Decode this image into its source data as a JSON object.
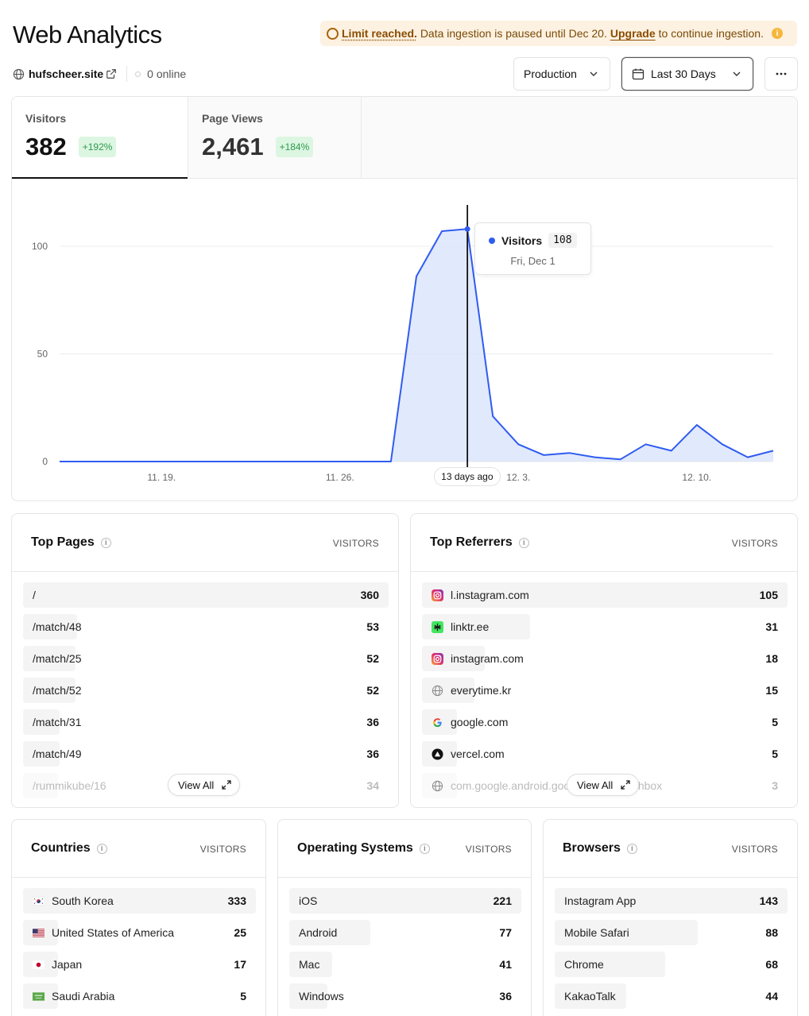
{
  "header": {
    "title": "Web Analytics",
    "banner": {
      "strong": "Limit reached.",
      "text": "Data ingestion is paused until Dec 20.",
      "link": "Upgrade",
      "tail": "to continue ingestion."
    },
    "site": "hufscheer.site",
    "online": "0 online",
    "environment": "Production",
    "range": "Last 30 Days"
  },
  "stats": {
    "visitors": {
      "label": "Visitors",
      "value": "382",
      "change": "+192%"
    },
    "page_views": {
      "label": "Page Views",
      "value": "2,461",
      "change": "+184%"
    }
  },
  "tooltip": {
    "series": "Visitors",
    "value": "108",
    "date": "Fri, Dec 1"
  },
  "chart_data": {
    "type": "area",
    "series": [
      {
        "name": "Visitors",
        "values": [
          0,
          0,
          0,
          0,
          0,
          0,
          0,
          0,
          0,
          0,
          0,
          0,
          0,
          0,
          86,
          107,
          108,
          21,
          8,
          3,
          4,
          2,
          1,
          8,
          5,
          17,
          8,
          2,
          5
        ]
      }
    ],
    "x_ticks": [
      "11. 19.",
      "11. 26.",
      "12. 3.",
      "12. 10."
    ],
    "highlight_label": "13 days ago",
    "y_ticks": [
      "0",
      "50",
      "100"
    ],
    "ylim": [
      0,
      115
    ],
    "color": "#2f5cf0"
  },
  "top_pages": {
    "title": "Top Pages",
    "column": "VISITORS",
    "view_all": "View All",
    "rows": [
      {
        "label": "/",
        "value": 360
      },
      {
        "label": "/match/48",
        "value": 53
      },
      {
        "label": "/match/25",
        "value": 52
      },
      {
        "label": "/match/52",
        "value": 52
      },
      {
        "label": "/match/31",
        "value": 36
      },
      {
        "label": "/match/49",
        "value": 36
      },
      {
        "label": "/rummikube/16",
        "value": 34
      }
    ]
  },
  "top_referrers": {
    "title": "Top Referrers",
    "column": "VISITORS",
    "view_all": "View All",
    "rows": [
      {
        "label": "l.instagram.com",
        "value": 105,
        "icon": "instagram-icon"
      },
      {
        "label": "linktr.ee",
        "value": 31,
        "icon": "linktree-icon"
      },
      {
        "label": "instagram.com",
        "value": 18,
        "icon": "instagram-icon"
      },
      {
        "label": "everytime.kr",
        "value": 15,
        "icon": "globe-icon"
      },
      {
        "label": "google.com",
        "value": 5,
        "icon": "google-icon"
      },
      {
        "label": "vercel.com",
        "value": 5,
        "icon": "vercel-icon"
      },
      {
        "label": "com.google.android.googlequicksearchbox",
        "value": 3,
        "icon": "globe-icon"
      }
    ]
  },
  "countries": {
    "title": "Countries",
    "column": "VISITORS",
    "rows": [
      {
        "label": "South Korea",
        "value": 333,
        "icon": "flag-kr-icon"
      },
      {
        "label": "United States of America",
        "value": 25,
        "icon": "flag-us-icon"
      },
      {
        "label": "Japan",
        "value": 17,
        "icon": "flag-jp-icon"
      },
      {
        "label": "Saudi Arabia",
        "value": 5,
        "icon": "flag-sa-icon"
      }
    ]
  },
  "operating_systems": {
    "title": "Operating Systems",
    "column": "VISITORS",
    "rows": [
      {
        "label": "iOS",
        "value": 221
      },
      {
        "label": "Android",
        "value": 77
      },
      {
        "label": "Mac",
        "value": 41
      },
      {
        "label": "Windows",
        "value": 36
      }
    ]
  },
  "browsers": {
    "title": "Browsers",
    "column": "VISITORS",
    "rows": [
      {
        "label": "Instagram App",
        "value": 143
      },
      {
        "label": "Mobile Safari",
        "value": 88
      },
      {
        "label": "Chrome",
        "value": 68
      },
      {
        "label": "KakaoTalk",
        "value": 44
      }
    ]
  }
}
